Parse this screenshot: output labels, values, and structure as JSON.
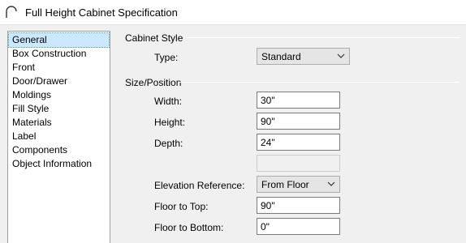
{
  "window": {
    "title": "Full Height Cabinet Specification",
    "icon": "cabinet-arc-icon"
  },
  "sidebar": {
    "items": [
      {
        "label": "General",
        "selected": true
      },
      {
        "label": "Box Construction"
      },
      {
        "label": "Front"
      },
      {
        "label": "Door/Drawer"
      },
      {
        "label": "Moldings"
      },
      {
        "label": "Fill Style"
      },
      {
        "label": "Materials"
      },
      {
        "label": "Label"
      },
      {
        "label": "Components"
      },
      {
        "label": "Object Information"
      }
    ]
  },
  "cabinet_style": {
    "header": "Cabinet Style",
    "type_label": "Type:",
    "type_value": "Standard"
  },
  "size_position": {
    "header": "Size/Position",
    "width_label": "Width:",
    "width_value": "30\"",
    "height_label": "Height:",
    "height_value": "90\"",
    "depth_label": "Depth:",
    "depth_value": "24\"",
    "blank_value": "",
    "elevation_label": "Elevation Reference:",
    "elevation_value": "From Floor",
    "floor_top_label": "Floor to Top:",
    "floor_top_value": "90\"",
    "floor_bottom_label": "Floor to Bottom:",
    "floor_bottom_value": "0\""
  },
  "colors": {
    "selection": "#cce8ff",
    "selection_border": "#26a0da"
  }
}
